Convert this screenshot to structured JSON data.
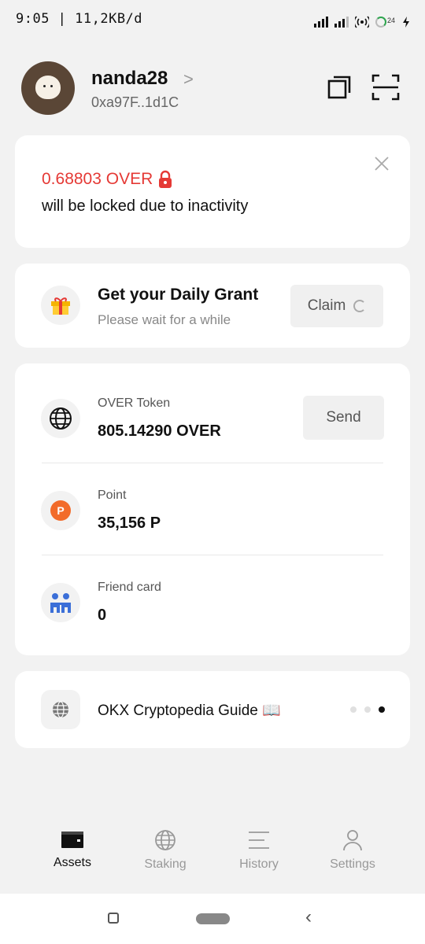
{
  "status_bar": {
    "time": "9:05 | 11,2KB/d",
    "battery": "24"
  },
  "header": {
    "username": "nanda28",
    "address": "0xa97F..1d1C",
    "chevron": ">"
  },
  "lock_notice": {
    "amount": "0.68803 OVER",
    "message": "will be locked due to inactivity",
    "lock_color": "#e53935"
  },
  "daily_grant": {
    "title": "Get your Daily Grant",
    "subtitle": "Please wait for a while",
    "button_label": "Claim"
  },
  "assets": [
    {
      "label": "OVER Token",
      "value": "805.14290 OVER",
      "icon": "globe-icon"
    },
    {
      "label": "Point",
      "value": "35,156 P",
      "icon": "point-coin-icon"
    },
    {
      "label": "Friend card",
      "value": "0",
      "icon": "friends-icon"
    }
  ],
  "send_button": "Send",
  "point_icon_letter": "P",
  "guide": {
    "title": "OKX Cryptopedia Guide 📖",
    "dots_total": 3,
    "active_dot": 3
  },
  "bottom_nav": [
    {
      "label": "Assets",
      "active": true
    },
    {
      "label": "Staking",
      "active": false
    },
    {
      "label": "History",
      "active": false
    },
    {
      "label": "Settings",
      "active": false
    }
  ],
  "system_nav": {
    "back": "‹"
  }
}
